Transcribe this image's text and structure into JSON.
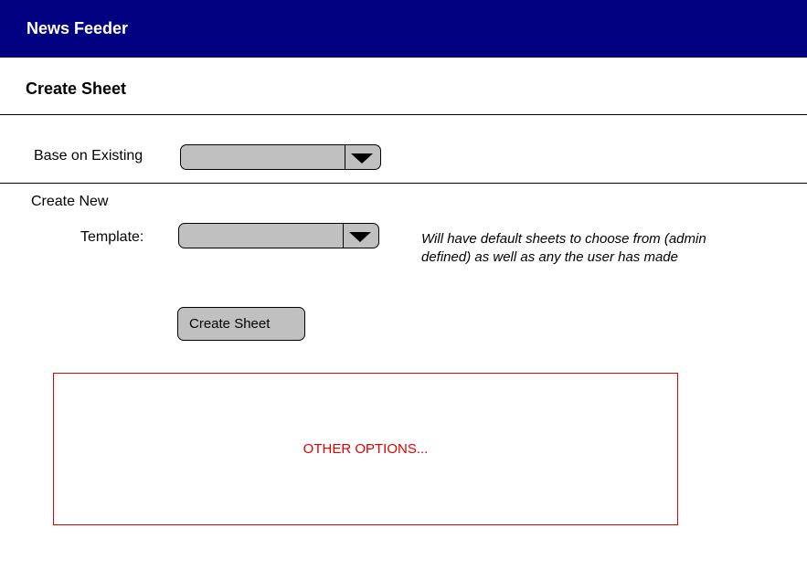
{
  "header": {
    "app_title": "News Feeder",
    "background_color": "#000080"
  },
  "page": {
    "title": "Create Sheet"
  },
  "base_on_existing": {
    "label": "Base on Existing",
    "selected_value": "",
    "arrow_icon": "triangle-down-icon"
  },
  "create_new": {
    "section_label": "Create New",
    "template": {
      "label": "Template:",
      "selected_value": "",
      "arrow_icon": "triangle-down-icon"
    },
    "note": "Will have default sheets to choose from (admin defined) as well as any the user has made"
  },
  "actions": {
    "create_sheet_label": "Create Sheet"
  },
  "other_options": {
    "text": "OTHER OPTIONS...",
    "color": "#e00000"
  }
}
